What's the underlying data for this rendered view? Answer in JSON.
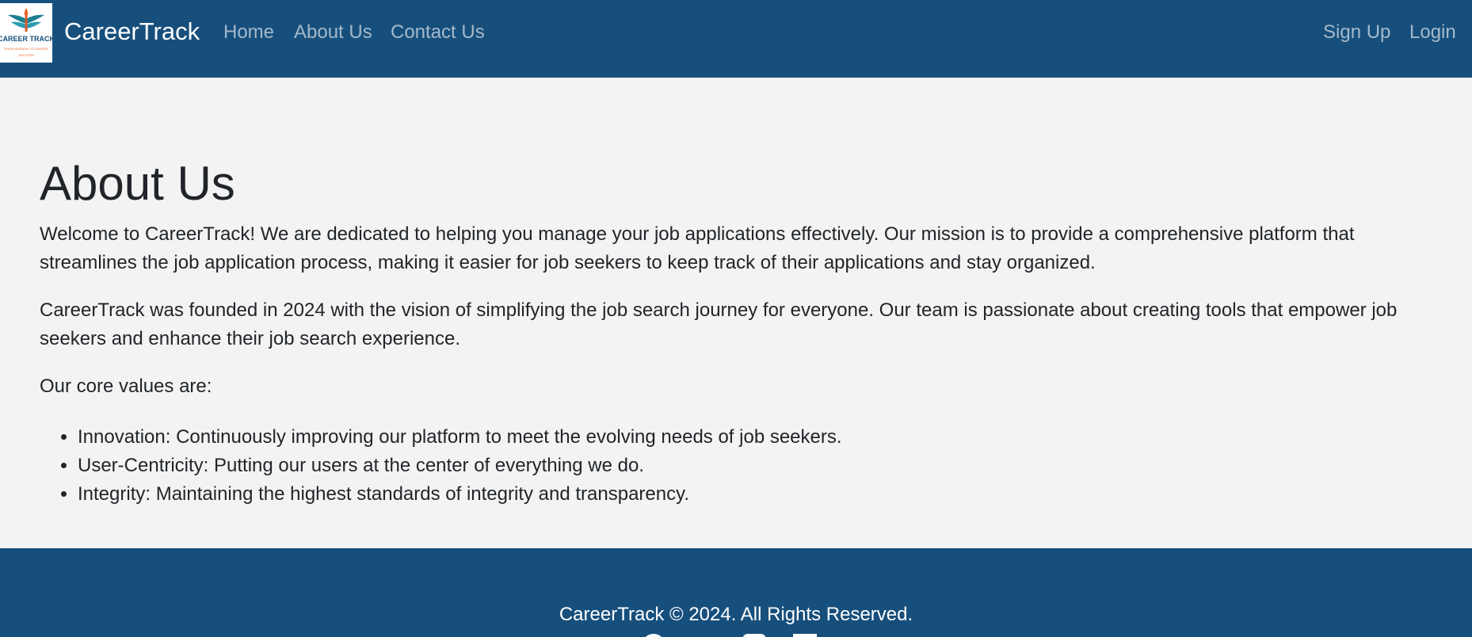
{
  "nav": {
    "brand": "CareerTrack",
    "logo": {
      "title": "CAREER TRACK",
      "tagline": "FROM PASSION TO CAREER",
      "sub": "SUCCESS"
    },
    "links": [
      "Home",
      "About Us",
      "Contact Us"
    ],
    "right_links": [
      "Sign Up",
      "Login"
    ]
  },
  "about": {
    "title": "About Us",
    "paragraphs": [
      "Welcome to CareerTrack! We are dedicated to helping you manage your job applications effectively. Our mission is to provide a comprehensive platform that streamlines the job application process, making it easier for job seekers to keep track of their applications and stay organized.",
      "CareerTrack was founded in 2024 with the vision of simplifying the job search journey for everyone. Our team is passionate about creating tools that empower job seekers and enhance their job search experience.",
      "Our core values are:"
    ],
    "values": [
      "Innovation: Continuously improving our platform to meet the evolving needs of job seekers.",
      "User-Centricity: Putting our users at the center of everything we do.",
      "Integrity: Maintaining the highest standards of integrity and transparency."
    ]
  },
  "footer": {
    "copyright": "CareerTrack © 2024. All Rights Reserved.",
    "social_icons": [
      "github-icon",
      "instagram-icon",
      "linkedin-icon"
    ]
  },
  "colors": {
    "navbar_bg": "#174f7c",
    "footer_bg": "#174f7c",
    "page_bg": "#f3f3f3",
    "text": "#212529",
    "nav_link": "rgba(255,255,255,0.6)"
  }
}
